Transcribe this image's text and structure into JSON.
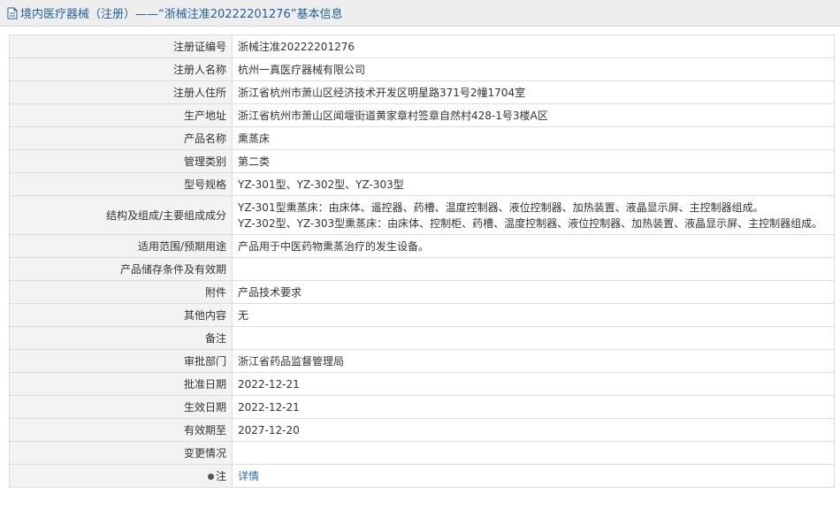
{
  "header": {
    "title": "境内医疗器械（注册）——“浙械注准20222201276”基本信息"
  },
  "rows": [
    {
      "label": "注册证编号",
      "value": "浙械注准20222201276"
    },
    {
      "label": "注册人名称",
      "value": "杭州一真医疗器械有限公司"
    },
    {
      "label": "注册人住所",
      "value": "浙江省杭州市萧山区经济技术开发区明星路371号2幢1704室"
    },
    {
      "label": "生产地址",
      "value": "浙江省杭州市萧山区闻堰街道黄家章村签章自然村428-1号3楼A区"
    },
    {
      "label": "产品名称",
      "value": "熏蒸床"
    },
    {
      "label": "管理类别",
      "value": "第二类"
    },
    {
      "label": "型号规格",
      "value": "YZ-301型、YZ-302型、YZ-303型"
    },
    {
      "label": "结构及组成/主要组成成分",
      "value_lines": [
        "YZ-301型熏蒸床：由床体、遥控器、药槽、温度控制器、液位控制器、加热装置、液晶显示屏、主控制器组成。",
        "YZ-302型、YZ-303型熏蒸床：由床体、控制柜、药槽、温度控制器、液位控制器、加热装置、液晶显示屏、主控制器组成。"
      ]
    },
    {
      "label": "适用范围/预期用途",
      "value": "产品用于中医药物熏蒸治疗的发生设备。"
    },
    {
      "label": "产品储存条件及有效期",
      "value": ""
    },
    {
      "label": "附件",
      "value": "产品技术要求"
    },
    {
      "label": "其他内容",
      "value": "无"
    },
    {
      "label": "备注",
      "value": ""
    },
    {
      "label": "审批部门",
      "value": "浙江省药品监督管理局"
    },
    {
      "label": "批准日期",
      "value": "2022-12-21"
    },
    {
      "label": "生效日期",
      "value": "2022-12-21"
    },
    {
      "label": "有效期至",
      "value": "2027-12-20"
    },
    {
      "label": "变更情况",
      "value": ""
    },
    {
      "label": "注",
      "icon": "pin-icon",
      "link": "详情"
    }
  ]
}
